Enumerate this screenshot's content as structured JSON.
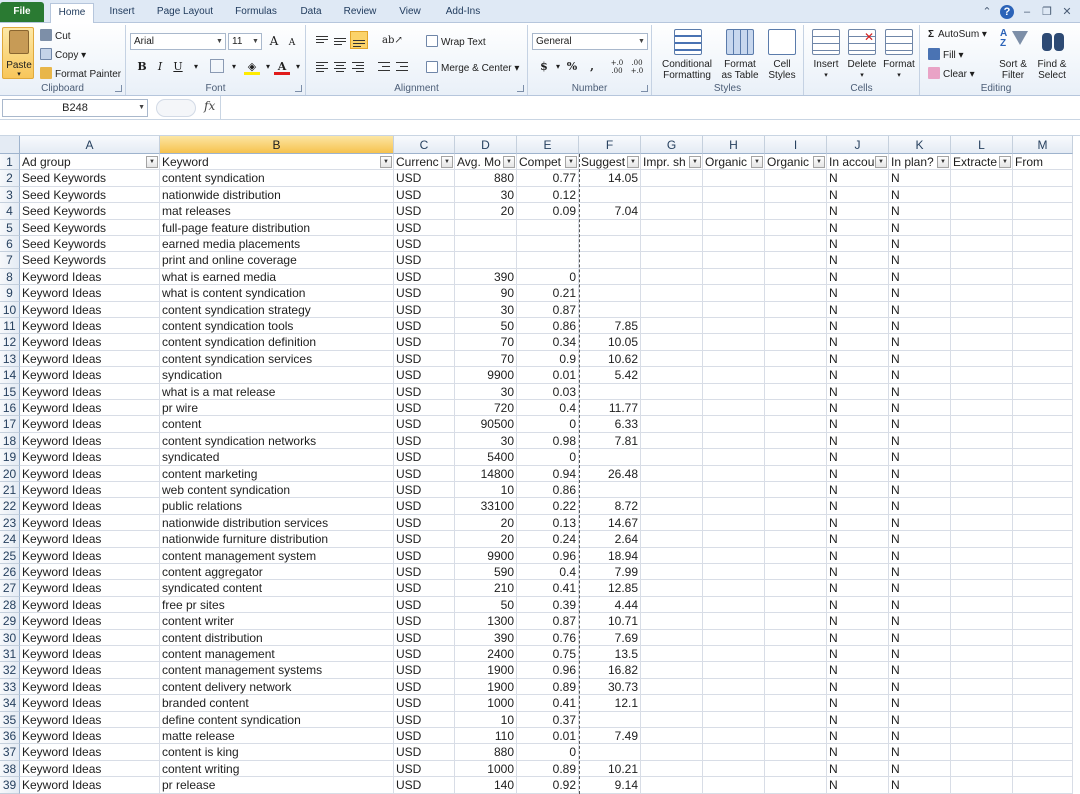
{
  "tabs": [
    "File",
    "Home",
    "Insert",
    "Page Layout",
    "Formulas",
    "Data",
    "Review",
    "View",
    "Add-Ins"
  ],
  "ribbon": {
    "clipboard": {
      "paste": "Paste",
      "cut": "Cut",
      "copy": "Copy",
      "format_painter": "Format Painter",
      "label": "Clipboard"
    },
    "font": {
      "name": "Arial",
      "size": "11",
      "bold": "B",
      "italic": "I",
      "underline": "U",
      "grow": "A",
      "shrink": "A",
      "font_color": "A",
      "label": "Font"
    },
    "alignment": {
      "wrap_text": "Wrap Text",
      "merge_center": "Merge & Center",
      "label": "Alignment"
    },
    "number": {
      "format": "General",
      "currency": "$",
      "percent": "%",
      "comma": ",",
      "inc_dec": "+.0 .00",
      "dec_dec": ".00 +.0",
      "label": "Number"
    },
    "styles": {
      "conditional": "Conditional Formatting",
      "format_table": "Format as Table",
      "cell_styles": "Cell Styles",
      "label": "Styles"
    },
    "cells": {
      "insert": "Insert",
      "delete": "Delete",
      "format": "Format",
      "label": "Cells"
    },
    "editing": {
      "autosum": "AutoSum",
      "fill": "Fill",
      "clear": "Clear",
      "sort_filter": "Sort & Filter",
      "find_select": "Find & Select",
      "label": "Editing"
    }
  },
  "formula_bar": {
    "name_box": "B248",
    "fx": "fx",
    "value": ""
  },
  "columns": [
    "A",
    "B",
    "C",
    "D",
    "E",
    "F",
    "G",
    "H",
    "I",
    "J",
    "K",
    "L",
    "M"
  ],
  "selected_column": "B",
  "header_row": [
    "Ad group",
    "Keyword",
    "Currenc",
    "Avg. Mo",
    "Compet",
    "Suggest",
    "Impr. sh",
    "Organic",
    "Organic",
    "In accou",
    "In plan?",
    "Extracte",
    "From"
  ],
  "rows": [
    [
      "Seed Keywords",
      "content syndication",
      "USD",
      "880",
      "0.77",
      "14.05",
      "",
      "",
      "",
      "N",
      "N",
      "",
      ""
    ],
    [
      "Seed Keywords",
      "nationwide distribution",
      "USD",
      "30",
      "0.12",
      "",
      "",
      "",
      "",
      "N",
      "N",
      "",
      ""
    ],
    [
      "Seed Keywords",
      "mat releases",
      "USD",
      "20",
      "0.09",
      "7.04",
      "",
      "",
      "",
      "N",
      "N",
      "",
      ""
    ],
    [
      "Seed Keywords",
      "full-page feature distribution",
      "USD",
      "",
      "",
      "",
      "",
      "",
      "",
      "N",
      "N",
      "",
      ""
    ],
    [
      "Seed Keywords",
      "earned media placements",
      "USD",
      "",
      "",
      "",
      "",
      "",
      "",
      "N",
      "N",
      "",
      ""
    ],
    [
      "Seed Keywords",
      "print and online coverage",
      "USD",
      "",
      "",
      "",
      "",
      "",
      "",
      "N",
      "N",
      "",
      ""
    ],
    [
      "Keyword Ideas",
      "what is earned media",
      "USD",
      "390",
      "0",
      "",
      "",
      "",
      "",
      "N",
      "N",
      "",
      ""
    ],
    [
      "Keyword Ideas",
      "what is content syndication",
      "USD",
      "90",
      "0.21",
      "",
      "",
      "",
      "",
      "N",
      "N",
      "",
      ""
    ],
    [
      "Keyword Ideas",
      "content syndication strategy",
      "USD",
      "30",
      "0.87",
      "",
      "",
      "",
      "",
      "N",
      "N",
      "",
      ""
    ],
    [
      "Keyword Ideas",
      "content syndication tools",
      "USD",
      "50",
      "0.86",
      "7.85",
      "",
      "",
      "",
      "N",
      "N",
      "",
      ""
    ],
    [
      "Keyword Ideas",
      "content syndication definition",
      "USD",
      "70",
      "0.34",
      "10.05",
      "",
      "",
      "",
      "N",
      "N",
      "",
      ""
    ],
    [
      "Keyword Ideas",
      "content syndication services",
      "USD",
      "70",
      "0.9",
      "10.62",
      "",
      "",
      "",
      "N",
      "N",
      "",
      ""
    ],
    [
      "Keyword Ideas",
      "syndication",
      "USD",
      "9900",
      "0.01",
      "5.42",
      "",
      "",
      "",
      "N",
      "N",
      "",
      ""
    ],
    [
      "Keyword Ideas",
      "what is a mat release",
      "USD",
      "30",
      "0.03",
      "",
      "",
      "",
      "",
      "N",
      "N",
      "",
      ""
    ],
    [
      "Keyword Ideas",
      "pr wire",
      "USD",
      "720",
      "0.4",
      "11.77",
      "",
      "",
      "",
      "N",
      "N",
      "",
      ""
    ],
    [
      "Keyword Ideas",
      "content",
      "USD",
      "90500",
      "0",
      "6.33",
      "",
      "",
      "",
      "N",
      "N",
      "",
      ""
    ],
    [
      "Keyword Ideas",
      "content syndication networks",
      "USD",
      "30",
      "0.98",
      "7.81",
      "",
      "",
      "",
      "N",
      "N",
      "",
      ""
    ],
    [
      "Keyword Ideas",
      "syndicated",
      "USD",
      "5400",
      "0",
      "",
      "",
      "",
      "",
      "N",
      "N",
      "",
      ""
    ],
    [
      "Keyword Ideas",
      "content marketing",
      "USD",
      "14800",
      "0.94",
      "26.48",
      "",
      "",
      "",
      "N",
      "N",
      "",
      ""
    ],
    [
      "Keyword Ideas",
      "web content syndication",
      "USD",
      "10",
      "0.86",
      "",
      "",
      "",
      "",
      "N",
      "N",
      "",
      ""
    ],
    [
      "Keyword Ideas",
      "public relations",
      "USD",
      "33100",
      "0.22",
      "8.72",
      "",
      "",
      "",
      "N",
      "N",
      "",
      ""
    ],
    [
      "Keyword Ideas",
      "nationwide distribution services",
      "USD",
      "20",
      "0.13",
      "14.67",
      "",
      "",
      "",
      "N",
      "N",
      "",
      ""
    ],
    [
      "Keyword Ideas",
      "nationwide furniture distribution",
      "USD",
      "20",
      "0.24",
      "2.64",
      "",
      "",
      "",
      "N",
      "N",
      "",
      ""
    ],
    [
      "Keyword Ideas",
      "content management system",
      "USD",
      "9900",
      "0.96",
      "18.94",
      "",
      "",
      "",
      "N",
      "N",
      "",
      ""
    ],
    [
      "Keyword Ideas",
      "content aggregator",
      "USD",
      "590",
      "0.4",
      "7.99",
      "",
      "",
      "",
      "N",
      "N",
      "",
      ""
    ],
    [
      "Keyword Ideas",
      "syndicated content",
      "USD",
      "210",
      "0.41",
      "12.85",
      "",
      "",
      "",
      "N",
      "N",
      "",
      ""
    ],
    [
      "Keyword Ideas",
      "free pr sites",
      "USD",
      "50",
      "0.39",
      "4.44",
      "",
      "",
      "",
      "N",
      "N",
      "",
      ""
    ],
    [
      "Keyword Ideas",
      "content writer",
      "USD",
      "1300",
      "0.87",
      "10.71",
      "",
      "",
      "",
      "N",
      "N",
      "",
      ""
    ],
    [
      "Keyword Ideas",
      "content distribution",
      "USD",
      "390",
      "0.76",
      "7.69",
      "",
      "",
      "",
      "N",
      "N",
      "",
      ""
    ],
    [
      "Keyword Ideas",
      "content management",
      "USD",
      "2400",
      "0.75",
      "13.5",
      "",
      "",
      "",
      "N",
      "N",
      "",
      ""
    ],
    [
      "Keyword Ideas",
      "content management systems",
      "USD",
      "1900",
      "0.96",
      "16.82",
      "",
      "",
      "",
      "N",
      "N",
      "",
      ""
    ],
    [
      "Keyword Ideas",
      "content delivery network",
      "USD",
      "1900",
      "0.89",
      "30.73",
      "",
      "",
      "",
      "N",
      "N",
      "",
      ""
    ],
    [
      "Keyword Ideas",
      "branded content",
      "USD",
      "1000",
      "0.41",
      "12.1",
      "",
      "",
      "",
      "N",
      "N",
      "",
      ""
    ],
    [
      "Keyword Ideas",
      "define content syndication",
      "USD",
      "10",
      "0.37",
      "",
      "",
      "",
      "",
      "N",
      "N",
      "",
      ""
    ],
    [
      "Keyword Ideas",
      "matte release",
      "USD",
      "110",
      "0.01",
      "7.49",
      "",
      "",
      "",
      "N",
      "N",
      "",
      ""
    ],
    [
      "Keyword Ideas",
      "content is king",
      "USD",
      "880",
      "0",
      "",
      "",
      "",
      "",
      "N",
      "N",
      "",
      ""
    ],
    [
      "Keyword Ideas",
      "content writing",
      "USD",
      "1000",
      "0.89",
      "10.21",
      "",
      "",
      "",
      "N",
      "N",
      "",
      ""
    ],
    [
      "Keyword Ideas",
      "pr release",
      "USD",
      "140",
      "0.92",
      "9.14",
      "",
      "",
      "",
      "N",
      "N",
      "",
      ""
    ]
  ]
}
